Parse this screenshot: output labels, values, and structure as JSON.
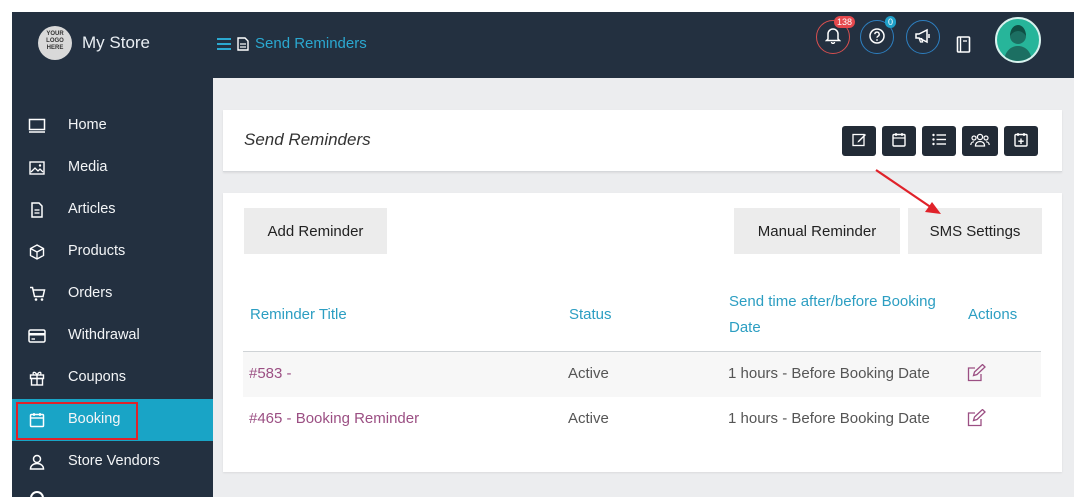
{
  "header": {
    "logo_text": "YOUR LOGO HERE",
    "store_name": "My Store",
    "breadcrumb": "Send Reminders",
    "notification_count": "138",
    "help_count": "0"
  },
  "sidebar": {
    "items": [
      {
        "label": "Home",
        "icon": "monitor-icon"
      },
      {
        "label": "Media",
        "icon": "image-icon"
      },
      {
        "label": "Articles",
        "icon": "document-icon"
      },
      {
        "label": "Products",
        "icon": "box-icon"
      },
      {
        "label": "Orders",
        "icon": "cart-icon"
      },
      {
        "label": "Withdrawal",
        "icon": "credit-card-icon"
      },
      {
        "label": "Coupons",
        "icon": "gift-icon"
      },
      {
        "label": "Booking",
        "icon": "calendar-icon",
        "active": true
      },
      {
        "label": "Store Vendors",
        "icon": "user-icon"
      }
    ]
  },
  "page": {
    "title": "Send Reminders"
  },
  "actions": {
    "add_reminder": "Add Reminder",
    "manual_reminder": "Manual Reminder",
    "sms_settings": "SMS Settings"
  },
  "table": {
    "headers": {
      "title": "Reminder Title",
      "status": "Status",
      "send_time_line1": "Send time after/before Booking",
      "send_time_line2": "Date",
      "actions": "Actions"
    },
    "rows": [
      {
        "title": "#583 -",
        "status": "Active",
        "send_time": "1 hours - Before Booking Date"
      },
      {
        "title": "#465 - Booking Reminder",
        "status": "Active",
        "send_time": "1 hours - Before Booking Date"
      }
    ]
  },
  "colors": {
    "topbar": "#233040",
    "accent": "#19a4c6",
    "link": "#9b4f83",
    "highlight": "#e0222a"
  }
}
